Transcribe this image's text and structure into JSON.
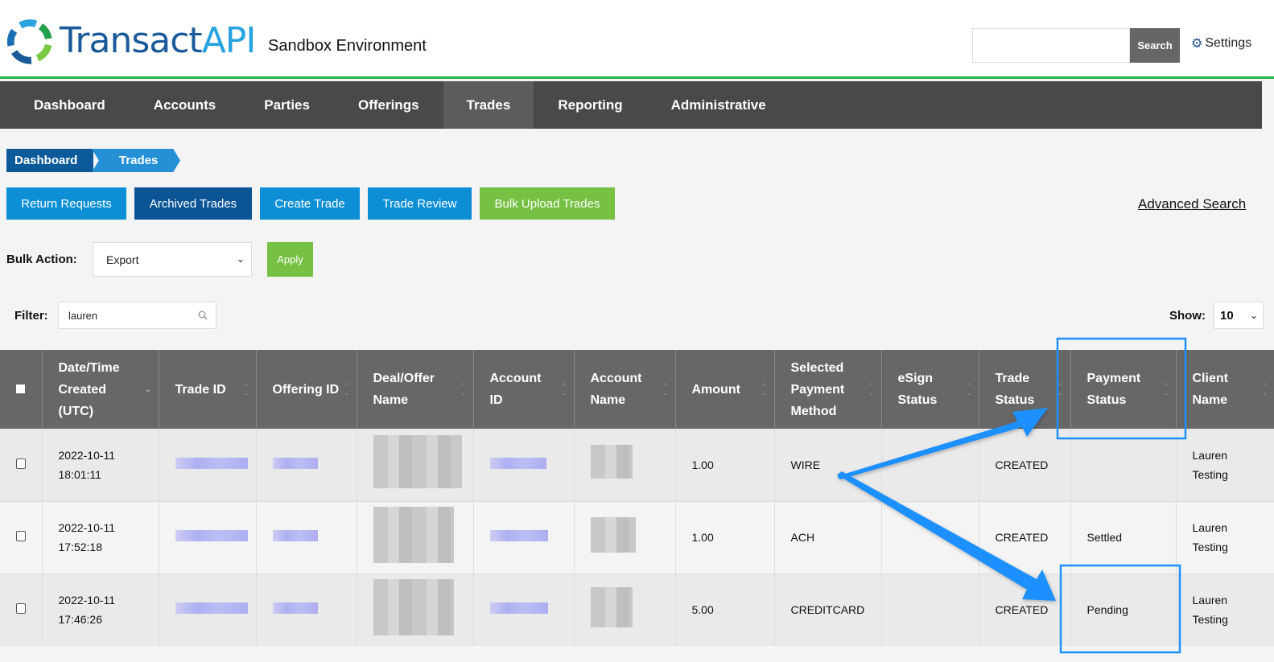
{
  "header": {
    "logo_text_1": "Transact",
    "logo_text_2": "API",
    "environment": "Sandbox Environment",
    "search_placeholder": "",
    "search_button": "Search",
    "settings_label": "Settings",
    "settings_icon": "gear-icon"
  },
  "nav": {
    "items": [
      {
        "label": "Dashboard",
        "active": false
      },
      {
        "label": "Accounts",
        "active": false
      },
      {
        "label": "Parties",
        "active": false
      },
      {
        "label": "Offerings",
        "active": false
      },
      {
        "label": "Trades",
        "active": true
      },
      {
        "label": "Reporting",
        "active": false
      },
      {
        "label": "Administrative",
        "active": false
      }
    ]
  },
  "breadcrumb": [
    "Dashboard",
    "Trades"
  ],
  "actions": {
    "buttons": [
      "Return Requests",
      "Archived Trades",
      "Create Trade",
      "Trade Review",
      "Bulk Upload Trades"
    ],
    "advanced_search": "Advanced Search"
  },
  "bulk": {
    "label": "Bulk Action:",
    "selected": "Export",
    "apply": "Apply"
  },
  "filter": {
    "label": "Filter:",
    "value": "lauren",
    "show_label": "Show:",
    "show_value": "10"
  },
  "table": {
    "headers": [
      "",
      "Date/Time Created (UTC)",
      "Trade ID",
      "Offering ID",
      "Deal/Offer Name",
      "Account ID",
      "Account Name",
      "Amount",
      "Selected Payment Method",
      "eSign Status",
      "Trade Status",
      "Payment Status",
      "Client Name"
    ],
    "rows": [
      {
        "date": "2022-10-11",
        "time": "18:01:11",
        "amount": "1.00",
        "method": "WIRE",
        "esign": "",
        "trade_status": "CREATED",
        "payment_status": "",
        "client_first": "Lauren",
        "client_last": "Testing"
      },
      {
        "date": "2022-10-11",
        "time": "17:52:18",
        "amount": "1.00",
        "method": "ACH",
        "esign": "",
        "trade_status": "CREATED",
        "payment_status": "Settled",
        "client_first": "Lauren",
        "client_last": "Testing"
      },
      {
        "date": "2022-10-11",
        "time": "17:46:26",
        "amount": "5.00",
        "method": "CREDITCARD",
        "esign": "",
        "trade_status": "CREATED",
        "payment_status": "Pending",
        "client_first": "Lauren",
        "client_last": "Testing"
      }
    ]
  },
  "colors": {
    "brand_dark_blue": "#1a5a9a",
    "brand_light_blue": "#27a3df",
    "accent_green": "#22b24c",
    "button_blue": "#0d8fd6",
    "button_dark": "#0b5597",
    "button_green": "#76c043",
    "nav_bg": "#494949",
    "table_header": "#676767",
    "status_link": "#3236c8",
    "annotation": "#1e90ff"
  }
}
